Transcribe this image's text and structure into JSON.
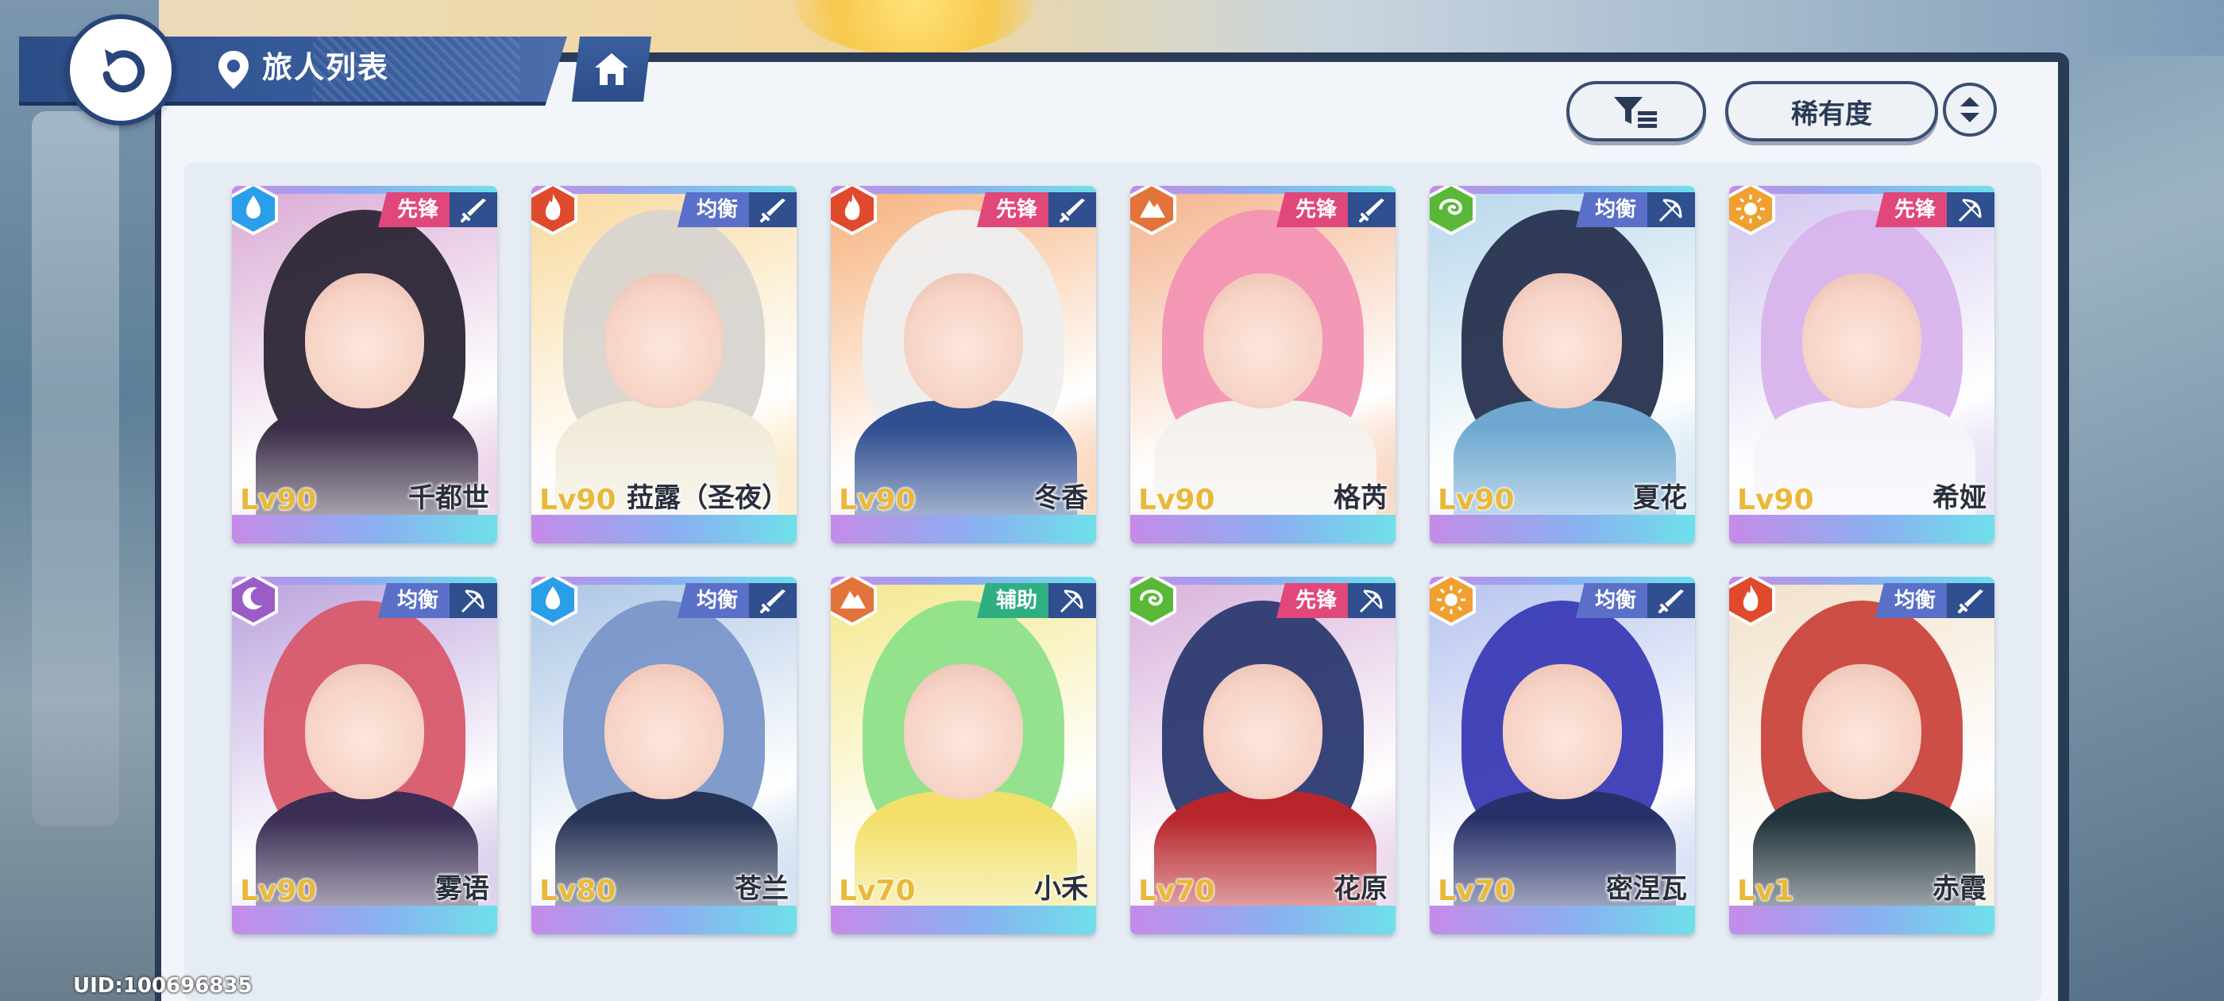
{
  "header": {
    "title": "旅人列表"
  },
  "controls": {
    "sort_label": "稀有度"
  },
  "uid": "UID:100696835",
  "colors": {
    "vanguard": "#e0487c",
    "balance": "#5a6fc8",
    "support": "#2fae83"
  },
  "characters": [
    {
      "level": "Lv90",
      "name": "千都世",
      "role": "先锋",
      "element": "water"
    },
    {
      "level": "Lv90",
      "name": "菈露（圣夜）",
      "role": "均衡",
      "element": "fire"
    },
    {
      "level": "Lv90",
      "name": "冬香",
      "role": "先锋",
      "element": "fire"
    },
    {
      "level": "Lv90",
      "name": "格芮",
      "role": "先锋",
      "element": "earth"
    },
    {
      "level": "Lv90",
      "name": "夏花",
      "role": "均衡",
      "element": "wind"
    },
    {
      "level": "Lv90",
      "name": "希娅",
      "role": "先锋",
      "element": "light"
    },
    {
      "level": "Lv90",
      "name": "雾语",
      "role": "均衡",
      "element": "dark"
    },
    {
      "level": "Lv80",
      "name": "苍兰",
      "role": "均衡",
      "element": "water"
    },
    {
      "level": "Lv70",
      "name": "小禾",
      "role": "辅助",
      "element": "earth"
    },
    {
      "level": "Lv70",
      "name": "花原",
      "role": "先锋",
      "element": "wind"
    },
    {
      "level": "Lv70",
      "name": "密涅瓦",
      "role": "均衡",
      "element": "light"
    },
    {
      "level": "Lv1",
      "name": "赤霞",
      "role": "均衡",
      "element": "fire"
    }
  ]
}
